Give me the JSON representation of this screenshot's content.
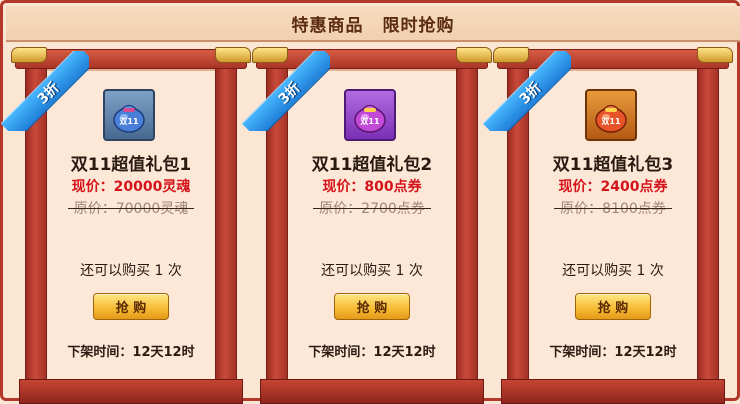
{
  "header": {
    "title_left": "特惠商品",
    "title_right": "限时抢购"
  },
  "cards": [
    {
      "badge": "3折",
      "name": "双11超值礼包1",
      "price_now": "现价：20000灵魂",
      "price_old": "原价：70000灵魂",
      "remain": "还可以购买 1 次",
      "buy_label": "抢 购",
      "offline": "下架时间：12天12时",
      "icon": "blue-gift-bag-icon",
      "bag_text": "双11"
    },
    {
      "badge": "3折",
      "name": "双11超值礼包2",
      "price_now": "现价：800点券",
      "price_old": "原价：2700点券",
      "remain": "还可以购买 1 次",
      "buy_label": "抢 购",
      "offline": "下架时间：12天12时",
      "icon": "purple-gift-bag-icon",
      "bag_text": "双11"
    },
    {
      "badge": "3折",
      "name": "双11超值礼包3",
      "price_now": "现价：2400点券",
      "price_old": "原价：8100点券",
      "remain": "还可以购买 1 次",
      "buy_label": "抢 购",
      "offline": "下架时间：12天12时",
      "icon": "orange-gift-bag-icon",
      "bag_text": "双11"
    }
  ],
  "colors": {
    "frame_red": "#b4382a",
    "price_now": "#d4141a",
    "ribbon_blue": "#1e7fd8",
    "button_gold": "#f6b932"
  }
}
